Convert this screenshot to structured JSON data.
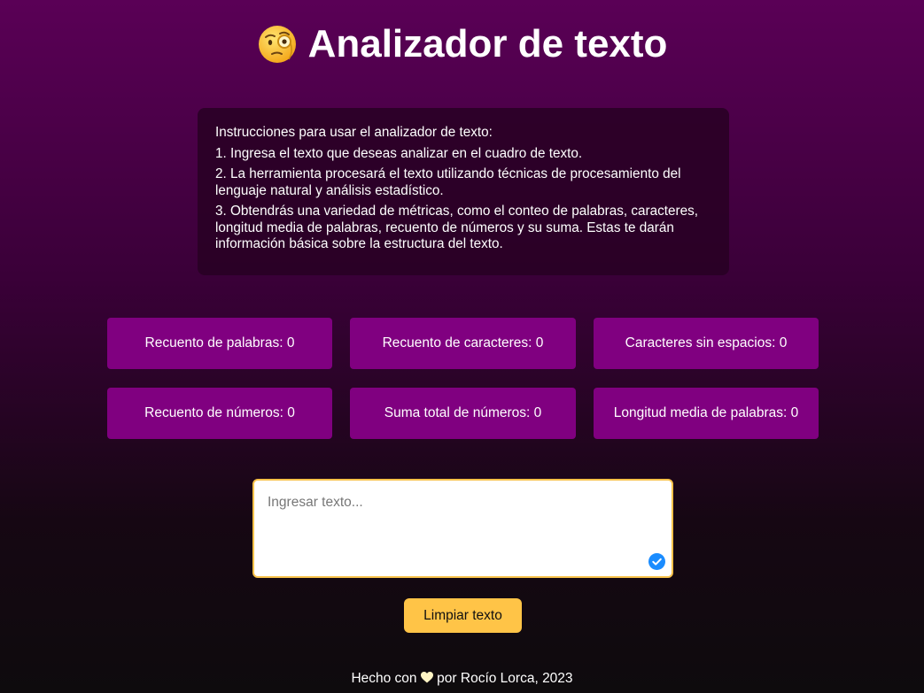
{
  "header": {
    "title": "Analizador de texto",
    "icon": "monocle-face-icon"
  },
  "instructions": {
    "heading": "Instrucciones para usar el analizador de texto:",
    "steps": [
      "1. Ingresa el texto que deseas analizar en el cuadro de texto.",
      "2. La herramienta procesará el texto utilizando técnicas de procesamiento del lenguaje natural y análisis estadístico.",
      "3. Obtendrás una variedad de métricas, como el conteo de palabras, caracteres, longitud media de palabras, recuento de números y su suma. Estas te darán información básica sobre la estructura del texto."
    ]
  },
  "metrics": [
    "Recuento de palabras: 0",
    "Recuento de caracteres: 0",
    "Caracteres sin espacios: 0",
    "Recuento de números: 0",
    "Suma total de números: 0",
    "Longitud media de palabras: 0"
  ],
  "input": {
    "placeholder": "Ingresar texto...",
    "value": ""
  },
  "buttons": {
    "clear_label": "Limpiar texto"
  },
  "footer": {
    "prefix": "Hecho con",
    "suffix": "por Rocío Lorca, 2023",
    "icon": "heart-icon"
  },
  "colors": {
    "card": "#800080",
    "accent": "#ffc447",
    "check": "#1a8cff"
  }
}
